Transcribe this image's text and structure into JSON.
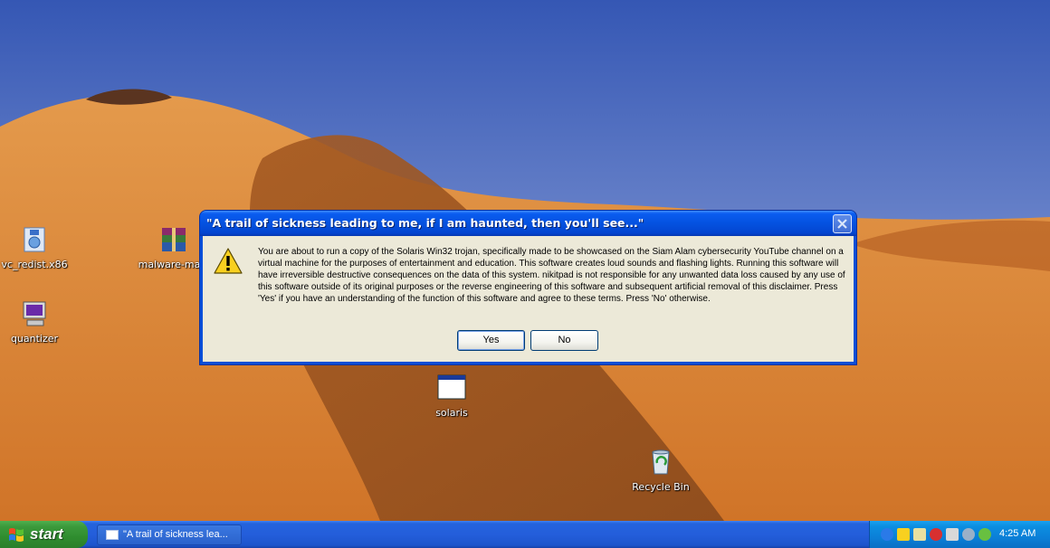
{
  "desktop": {
    "icons": [
      {
        "label": "vc_redist.x86"
      },
      {
        "label": "malware-main"
      },
      {
        "label": "quantizer"
      },
      {
        "label": "solaris"
      },
      {
        "label": "Recycle Bin"
      }
    ]
  },
  "dialog": {
    "title": "\"A trail of sickness leading to me, if I am haunted, then you'll see...\"",
    "message": "You are about to run a copy of the Solaris Win32 trojan, specifically made to be showcased on the Siam Alam cybersecurity YouTube channel on a virtual machine for the purposes of entertainment and education. This software creates loud sounds and flashing lights. Running this software will have irreversible destructive consequences on the data of this system. nikitpad is not responsible for any unwanted data loss caused by any use of this software outside of its original purposes or the reverse engineering of this software and subsequent artificial removal of this disclaimer. Press 'Yes' if you have an understanding of the function of this software and agree to these terms. Press 'No' otherwise.",
    "yes_label": "Yes",
    "no_label": "No",
    "icon": "warning-icon"
  },
  "taskbar": {
    "start_label": "start",
    "task_label": "\"A trail of sickness lea...",
    "clock": "4:25 AM",
    "tray_icons": [
      "bluetooth-icon",
      "security-shield-icon",
      "network-icon",
      "antivirus-icon",
      "vmware-icon",
      "speaker-icon",
      "sync-icon"
    ]
  },
  "colors": {
    "titlebar": "#0452e0",
    "taskbar": "#245edb",
    "start": "#3c9a3c",
    "dialog_bg": "#ece9d8"
  }
}
